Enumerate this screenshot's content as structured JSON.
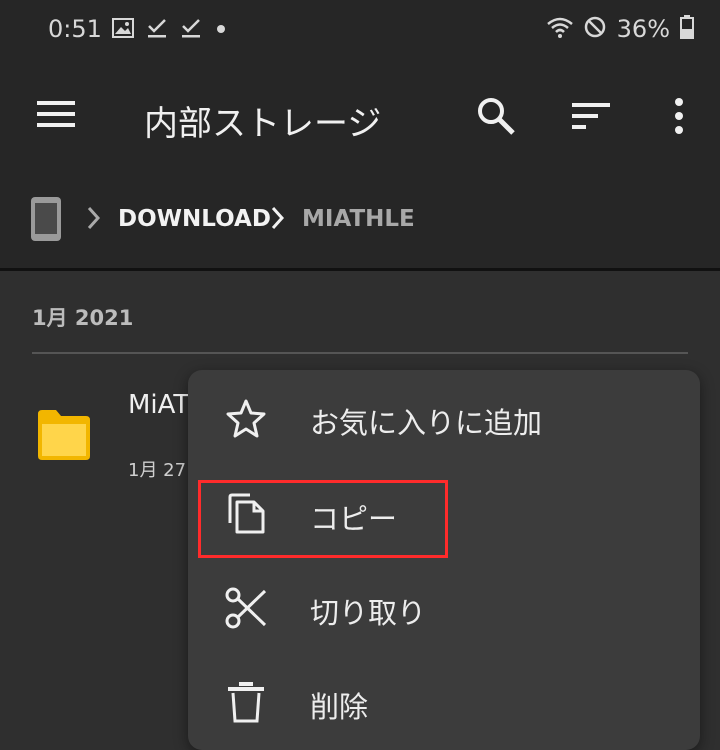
{
  "status_bar": {
    "time": "0:51",
    "battery": "36%",
    "icons": [
      "image-icon",
      "check-icon",
      "check-icon",
      "dot-icon",
      "wifi-icon",
      "do-not-disturb-icon",
      "battery-icon"
    ]
  },
  "app_bar": {
    "title": "内部ストレージ",
    "icons": [
      "menu-icon",
      "search-icon",
      "sort-icon",
      "more-vert-icon"
    ]
  },
  "breadcrumb": {
    "items": [
      "DOWNLOAD",
      "MIATHLE"
    ]
  },
  "section": {
    "label": "1月 2021"
  },
  "file": {
    "name_visible": "MiAT",
    "date_visible": "1月 27"
  },
  "context_menu": {
    "items": [
      {
        "label": "お気に入りに追加",
        "icon": "star-icon"
      },
      {
        "label": "コピー",
        "icon": "copy-icon"
      },
      {
        "label": "切り取り",
        "icon": "scissors-icon"
      },
      {
        "label": "削除",
        "icon": "trash-icon"
      }
    ]
  },
  "colors": {
    "background": "#2f2f2f",
    "bar": "#262626",
    "menu": "#3c3c3c",
    "folder": "#f2b600",
    "highlight": "#ff2b2b"
  }
}
